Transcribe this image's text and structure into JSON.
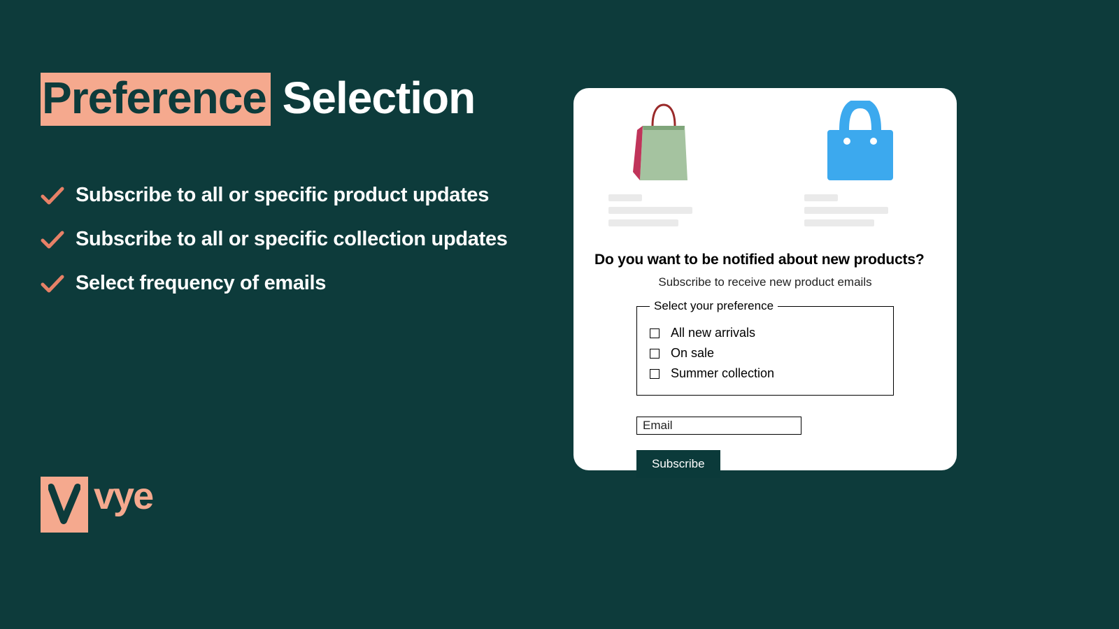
{
  "title": {
    "highlight": "Preference",
    "rest": "Selection"
  },
  "features": [
    "Subscribe to all or specific product updates",
    "Subscribe to all or specific collection updates",
    "Select frequency of emails"
  ],
  "logo": {
    "text": "vye"
  },
  "card": {
    "heading": "Do you want to be notified about new products?",
    "subheading": "Subscribe to receive new product emails",
    "fieldset_legend": "Select your preference",
    "options": [
      "All new arrivals",
      "On sale",
      "Summer collection"
    ],
    "email_placeholder": "Email",
    "subscribe_label": "Subscribe"
  }
}
